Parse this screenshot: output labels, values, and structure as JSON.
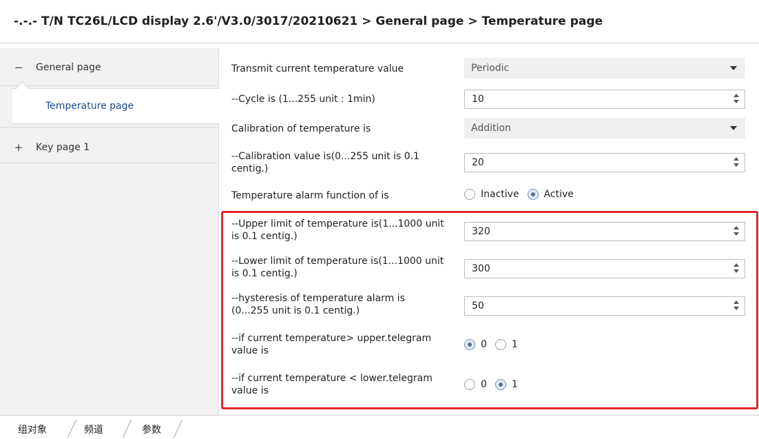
{
  "header": {
    "breadcrumb": "-.-.- T/N TC26L/LCD display 2.6'/V3.0/3017/20210621 > General page > Temperature page"
  },
  "sidebar": {
    "items": [
      {
        "sign": "−",
        "label": "General page"
      },
      {
        "label": "Temperature page",
        "selected": true
      },
      {
        "sign": "+",
        "label": "Key page 1"
      }
    ]
  },
  "params": {
    "transmit": {
      "label": "Transmit current temperature value",
      "value": "Periodic"
    },
    "cycle": {
      "label": "--Cycle is (1...255 unit : 1min)",
      "value": "10"
    },
    "calibration": {
      "label": "Calibration of temperature is",
      "value": "Addition"
    },
    "calibration_value": {
      "label": "--Calibration value is(0...255 unit is 0.1 centig.)",
      "value": "20"
    },
    "alarm_function": {
      "label": "Temperature alarm function of is",
      "options": [
        "Inactive",
        "Active"
      ],
      "selected": "Active"
    },
    "upper_limit": {
      "label": "--Upper limit of temperature is(1...1000 unit is 0.1 centig.)",
      "value": "320"
    },
    "lower_limit": {
      "label": "--Lower limit of temperature is(1...1000 unit is 0.1 centig.)",
      "value": "300"
    },
    "hysteresis": {
      "label": "--hysteresis of temperature alarm is (0...255 unit is 0.1 centig.)",
      "value": "50"
    },
    "if_upper": {
      "label": " --if current temperature> upper.telegram value is",
      "options": [
        "0",
        "1"
      ],
      "selected": "0"
    },
    "if_lower": {
      "label": "--if current temperature < lower.telegram value is",
      "options": [
        "0",
        "1"
      ],
      "selected": "1"
    }
  },
  "bottom_tabs": [
    "组对象",
    "频道",
    "参数"
  ],
  "colors": {
    "highlight": "#e02828",
    "selected_text": "#1c4b8c",
    "sidebar_bg": "#f2f2f2"
  }
}
